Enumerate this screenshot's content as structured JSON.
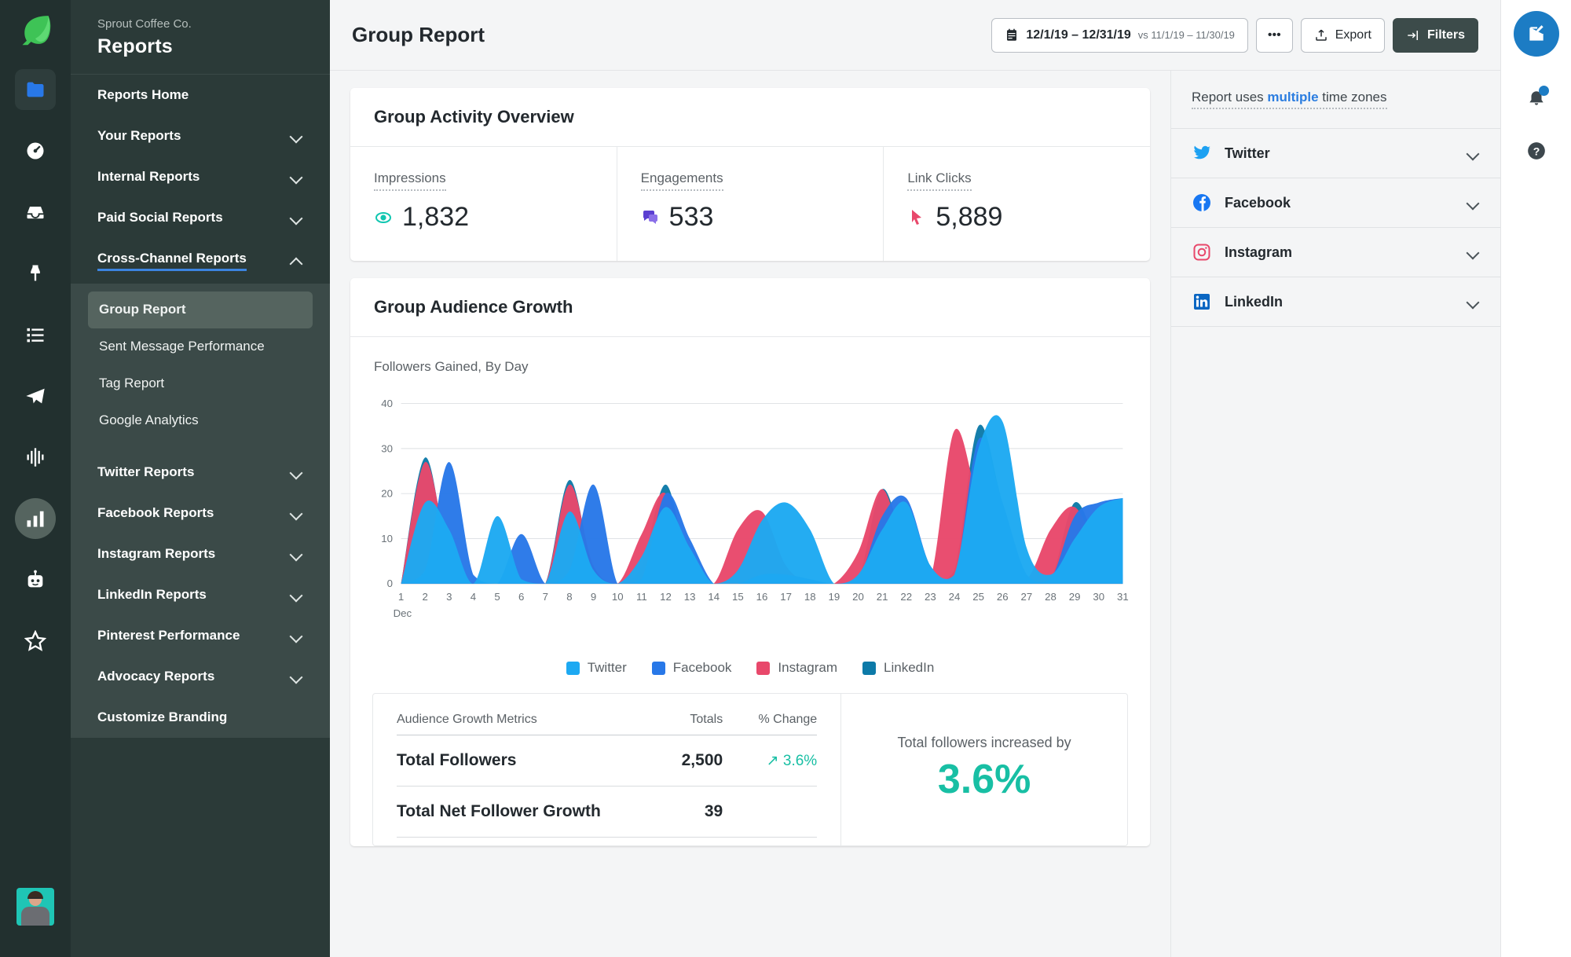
{
  "brand": {
    "logo": "sprout-leaf-logo",
    "accent": "#3c84e0"
  },
  "rail": {
    "items": [
      {
        "name": "dashboard-icon",
        "label": "Dashboard"
      },
      {
        "name": "inbox-icon",
        "label": "Smart Inbox"
      },
      {
        "name": "pin-icon",
        "label": "Publishing"
      },
      {
        "name": "list-icon",
        "label": "Tasks"
      },
      {
        "name": "send-icon",
        "label": "Messages"
      },
      {
        "name": "listening-icon",
        "label": "Listening"
      },
      {
        "name": "analytics-icon",
        "label": "Reports"
      },
      {
        "name": "bot-icon",
        "label": "Bot Builder"
      },
      {
        "name": "star-icon",
        "label": "Reviews"
      }
    ]
  },
  "sidebar": {
    "org": "Sprout Coffee Co.",
    "title": "Reports",
    "top_item": "Reports Home",
    "groups": [
      {
        "label": "Your Reports",
        "expanded": false
      },
      {
        "label": "Internal Reports",
        "expanded": false
      },
      {
        "label": "Paid Social Reports",
        "expanded": false
      },
      {
        "label": "Cross-Channel Reports",
        "expanded": true
      }
    ],
    "cross_channel_items": [
      "Group Report",
      "Sent Message Performance",
      "Tag Report",
      "Google Analytics"
    ],
    "selected_item": "Group Report",
    "lower_groups": [
      {
        "label": "Twitter Reports",
        "expanded": false
      },
      {
        "label": "Facebook Reports",
        "expanded": false
      },
      {
        "label": "Instagram Reports",
        "expanded": false
      },
      {
        "label": "LinkedIn Reports",
        "expanded": false
      },
      {
        "label": "Pinterest Performance",
        "expanded": false
      },
      {
        "label": "Advocacy Reports",
        "expanded": false
      }
    ],
    "customize_branding": "Customize Branding"
  },
  "topbar": {
    "page_title": "Group Report",
    "date_range": "12/1/19 – 12/31/19",
    "date_compare": "vs 11/1/19 – 11/30/19",
    "more_label": "•••",
    "export_label": "Export",
    "filters_label": "Filters"
  },
  "activity": {
    "card_title": "Group Activity Overview",
    "stats": [
      {
        "label": "Impressions",
        "value": "1,832",
        "icon": "eye-icon",
        "color": "#10c6b0"
      },
      {
        "label": "Engagements",
        "value": "533",
        "icon": "speech-bubble-icon",
        "color": "#5b3fd1"
      },
      {
        "label": "Link Clicks",
        "value": "5,889",
        "icon": "cursor-icon",
        "color": "#e8486b"
      }
    ]
  },
  "audience": {
    "card_title": "Group Audience Growth",
    "subtitle": "Followers Gained, By Day"
  },
  "metrics": {
    "col_metric": "Audience Growth Metrics",
    "col_totals": "Totals",
    "col_change": "% Change",
    "rows": [
      {
        "name": "Total Followers",
        "total": "2,500",
        "change": "3.6%",
        "trend": "up"
      },
      {
        "name": "Total Net Follower Growth",
        "total": "39",
        "change": "",
        "trend": ""
      }
    ],
    "callout_label": "Total followers increased by",
    "callout_value": "3.6%"
  },
  "right_panel": {
    "timezone_prefix": "Report uses ",
    "timezone_link": "multiple",
    "timezone_suffix": " time zones",
    "networks": [
      {
        "name": "Twitter",
        "icon": "twitter-icon",
        "color": "#1da1f2"
      },
      {
        "name": "Facebook",
        "icon": "facebook-icon",
        "color": "#1877f2"
      },
      {
        "name": "Instagram",
        "icon": "instagram-icon",
        "color": "#e8486b"
      },
      {
        "name": "LinkedIn",
        "icon": "linkedin-icon",
        "color": "#0a66c2"
      }
    ]
  },
  "far_rail": {
    "compose": "compose-icon",
    "notifications": "bell-icon",
    "help": "help-icon"
  },
  "chart_data": {
    "type": "area",
    "title": "Group Audience Growth",
    "subtitle": "Followers Gained, By Day",
    "xlabel": "Dec",
    "ylabel": "",
    "ylim": [
      0,
      40
    ],
    "yticks": [
      0,
      10,
      20,
      30,
      40
    ],
    "grid": true,
    "legend_position": "bottom",
    "x": [
      1,
      2,
      3,
      4,
      5,
      6,
      7,
      8,
      9,
      10,
      11,
      12,
      13,
      14,
      15,
      16,
      17,
      18,
      19,
      20,
      21,
      22,
      23,
      24,
      25,
      26,
      27,
      28,
      29,
      30,
      31
    ],
    "series": [
      {
        "name": "Twitter",
        "color": "#1da9f2",
        "values": [
          0,
          18,
          12,
          0,
          15,
          1,
          0,
          16,
          3,
          0,
          6,
          17,
          8,
          0,
          3,
          14,
          18,
          12,
          0,
          2,
          12,
          18,
          4,
          2,
          30,
          36,
          8,
          2,
          10,
          17,
          19
        ]
      },
      {
        "name": "Facebook",
        "color": "#2878e8",
        "values": [
          0,
          3,
          27,
          2,
          0,
          11,
          0,
          3,
          22,
          0,
          1,
          20,
          10,
          0,
          0,
          2,
          2,
          1,
          0,
          1,
          15,
          19,
          4,
          1,
          32,
          18,
          2,
          1,
          15,
          18,
          19
        ]
      },
      {
        "name": "Instagram",
        "color": "#e8486b",
        "values": [
          0,
          27,
          6,
          0,
          0,
          0,
          0,
          22,
          4,
          0,
          11,
          20,
          2,
          0,
          12,
          16,
          4,
          0,
          0,
          7,
          21,
          6,
          1,
          34,
          18,
          5,
          1,
          12,
          17,
          7,
          2
        ]
      },
      {
        "name": "LinkedIn",
        "color": "#0d7aa8",
        "values": [
          0,
          28,
          5,
          0,
          0,
          0,
          0,
          23,
          3,
          0,
          4,
          22,
          3,
          0,
          0,
          2,
          1,
          0,
          0,
          1,
          21,
          7,
          1,
          3,
          35,
          18,
          2,
          1,
          18,
          8,
          2
        ]
      }
    ]
  }
}
